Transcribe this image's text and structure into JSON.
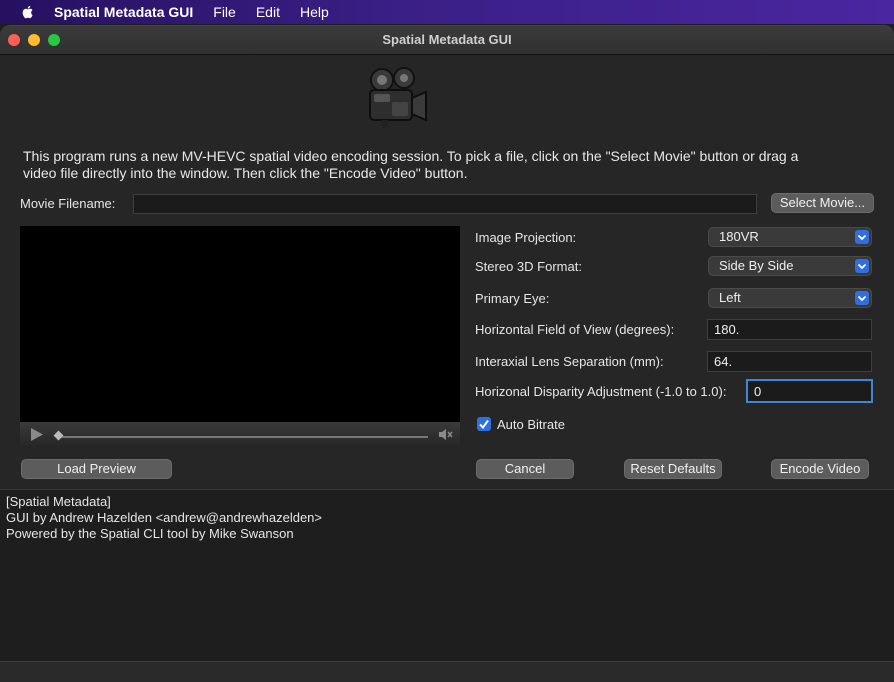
{
  "menubar": {
    "app_name": "Spatial Metadata GUI",
    "items": [
      "File",
      "Edit",
      "Help"
    ]
  },
  "window": {
    "title": "Spatial Metadata GUI"
  },
  "description": "This program runs a new MV-HEVC spatial video encoding session. To pick a file, click on the \"Select Movie\" button or drag a video file directly into the window. Then click the \"Encode Video\" button.",
  "movie": {
    "label": "Movie Filename:",
    "value": "",
    "select_button": "Select Movie..."
  },
  "settings": {
    "projection_label": "Image Projection:",
    "projection_value": "180VR",
    "stereo_label": "Stereo 3D Format:",
    "stereo_value": "Side By Side",
    "eye_label": "Primary Eye:",
    "eye_value": "Left",
    "hfov_label": "Horizontal Field of View (degrees):",
    "hfov_value": "180.",
    "ipd_label": "Interaxial Lens Separation (mm):",
    "ipd_value": "64.",
    "disparity_label": "Horizonal Disparity Adjustment (-1.0 to 1.0):",
    "disparity_value": "0",
    "auto_bitrate_label": "Auto Bitrate",
    "auto_bitrate_checked": true
  },
  "buttons": {
    "load_preview": "Load Preview",
    "cancel": "Cancel",
    "reset_defaults": "Reset Defaults",
    "encode_video": "Encode Video"
  },
  "log": {
    "lines": [
      "[Spatial Metadata]",
      "GUI by Andrew Hazelden <andrew@andrewhazelden>",
      "Powered by the Spatial CLI tool by Mike Swanson"
    ]
  },
  "colors": {
    "accent": "#2f6fe0",
    "focus_ring": "#3d86d8"
  }
}
